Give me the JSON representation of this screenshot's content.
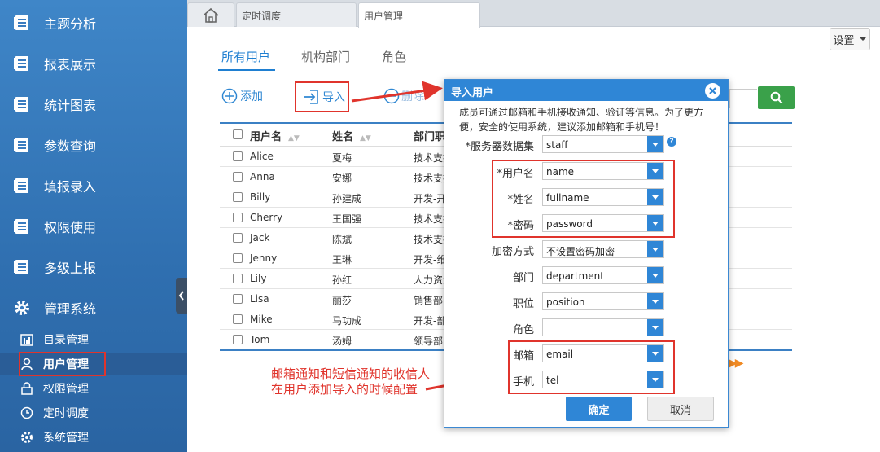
{
  "sidebar": {
    "items": [
      {
        "label": "主题分析",
        "icon": "report-icon"
      },
      {
        "label": "报表展示",
        "icon": "report-icon"
      },
      {
        "label": "统计图表",
        "icon": "report-icon"
      },
      {
        "label": "参数查询",
        "icon": "report-icon"
      },
      {
        "label": "填报录入",
        "icon": "report-icon"
      },
      {
        "label": "权限使用",
        "icon": "report-icon"
      },
      {
        "label": "多级上报",
        "icon": "report-icon"
      },
      {
        "label": "管理系统",
        "icon": "gear-icon"
      }
    ],
    "subitems": [
      {
        "label": "目录管理",
        "icon": "directory-icon"
      },
      {
        "label": "用户管理",
        "icon": "user-icon",
        "active": true
      },
      {
        "label": "权限管理",
        "icon": "lock-icon"
      },
      {
        "label": "定时调度",
        "icon": "clock-icon"
      },
      {
        "label": "系统管理",
        "icon": "gear-icon"
      }
    ]
  },
  "tabs": {
    "schedule": "定时调度",
    "users": "用户管理"
  },
  "settings_label": "设置",
  "subtabs": {
    "all_users": "所有用户",
    "departments": "机构部门",
    "roles": "角色"
  },
  "toolbar": {
    "add": "添加",
    "import": "导入",
    "delete": "删除"
  },
  "table": {
    "headers": {
      "username": "用户名",
      "fullname": "姓名",
      "department": "部门职"
    },
    "rows": [
      {
        "username": "Alice",
        "fullname": "夏梅",
        "department": "技术支持"
      },
      {
        "username": "Anna",
        "fullname": "安娜",
        "department": "技术支持"
      },
      {
        "username": "Billy",
        "fullname": "孙建成",
        "department": "开发-开发"
      },
      {
        "username": "Cherry",
        "fullname": "王国强",
        "department": "技术支持"
      },
      {
        "username": "Jack",
        "fullname": "陈斌",
        "department": "技术支持"
      },
      {
        "username": "Jenny",
        "fullname": "王琳",
        "department": "开发-维护"
      },
      {
        "username": "Lily",
        "fullname": "孙红",
        "department": "人力资源"
      },
      {
        "username": "Lisa",
        "fullname": "丽莎",
        "department": "销售部门"
      },
      {
        "username": "Mike",
        "fullname": "马功成",
        "department": "开发-部门"
      },
      {
        "username": "Tom",
        "fullname": "汤姆",
        "department": "领导部门"
      }
    ]
  },
  "dialog": {
    "title": "导入用户",
    "description": "成员可通过邮箱和手机接收通知、验证等信息。为了更方便，安全的使用系统，建议添加邮箱和手机号！",
    "fields": [
      {
        "label": "*服务器数据集",
        "value": "staff"
      },
      {
        "label": "*用户名",
        "value": "name"
      },
      {
        "label": "*姓名",
        "value": "fullname"
      },
      {
        "label": "*密码",
        "value": "password"
      },
      {
        "label": "加密方式",
        "value": "不设置密码加密"
      },
      {
        "label": "部门",
        "value": "department"
      },
      {
        "label": "职位",
        "value": "position"
      },
      {
        "label": "角色",
        "value": ""
      },
      {
        "label": "邮箱",
        "value": "email"
      },
      {
        "label": "手机",
        "value": "tel"
      }
    ],
    "ok": "确定",
    "cancel": "取消"
  },
  "annotation": {
    "line1": "邮箱通知和短信通知的收信人",
    "line2": "在用户添加导入的时候配置"
  },
  "colors": {
    "accent": "#2f86d6",
    "highlight": "#e0342c",
    "sidebar": "#3a7cc0",
    "search": "#3aa14a"
  }
}
